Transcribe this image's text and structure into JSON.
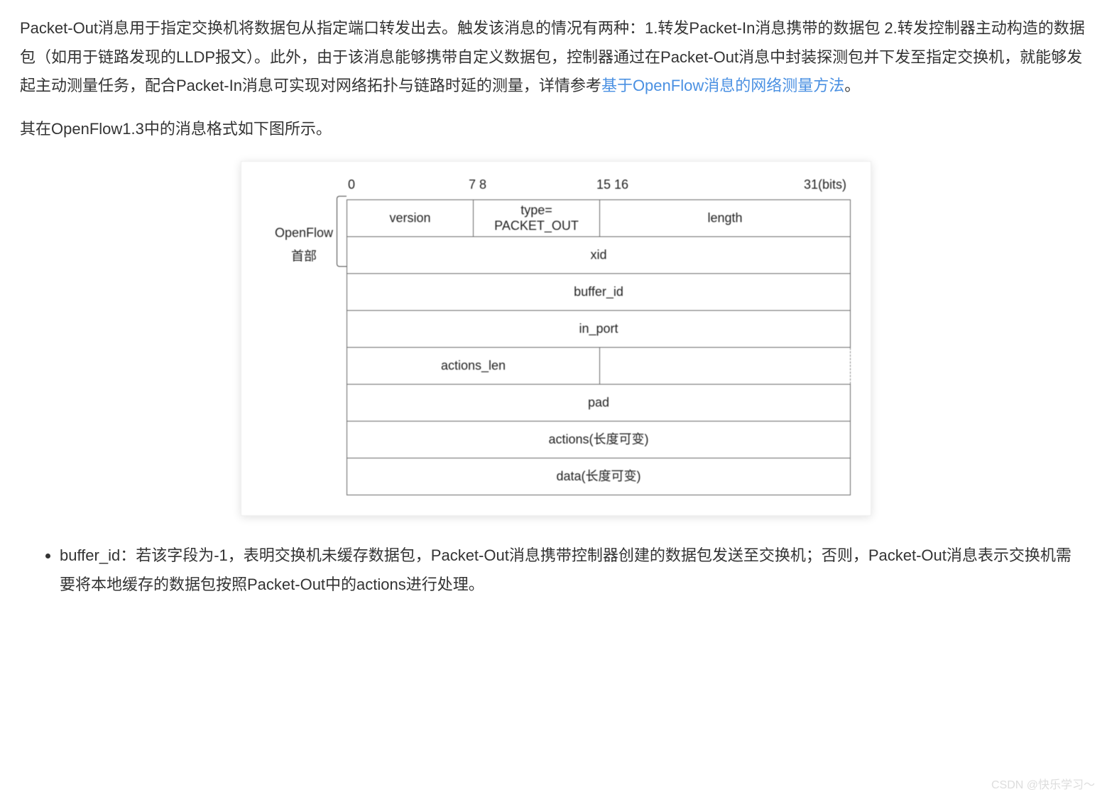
{
  "paragraphs": {
    "p1_before_link": "Packet-Out消息用于指定交换机将数据包从指定端口转发出去。触发该消息的情况有两种：1.转发Packet-In消息携带的数据包 2.转发控制器主动构造的数据包（如用于链路发现的LLDP报文）。此外，由于该消息能够携带自定义数据包，控制器通过在Packet-Out消息中封装探测包并下发至指定交换机，就能够发起主动测量任务，配合Packet-In消息可实现对网络拓扑与链路时延的测量，详情参考",
    "link_text": "基于OpenFlow消息的网络测量方法",
    "p1_after_link": "。",
    "p2": "其在OpenFlow1.3中的消息格式如下图所示。"
  },
  "diagram": {
    "side_label": "OpenFlow\n首部",
    "bit_labels": {
      "b0": "0",
      "b78": "7 8",
      "b1516": "15 16",
      "b31": "31(bits)"
    },
    "cells": {
      "version": "version",
      "type": "type=\nPACKET_OUT",
      "length": "length",
      "xid": "xid",
      "buffer_id": "buffer_id",
      "in_port": "in_port",
      "actions_len": "actions_len",
      "pad": "pad",
      "actions": "actions(长度可变)",
      "data": "data(长度可变)"
    }
  },
  "list": {
    "item1": "buffer_id：若该字段为-1，表明交换机未缓存数据包，Packet-Out消息携带控制器创建的数据包发送至交换机；否则，Packet-Out消息表示交换机需要将本地缓存的数据包按照Packet-Out中的actions进行处理。"
  },
  "watermark": "CSDN @快乐学习～"
}
